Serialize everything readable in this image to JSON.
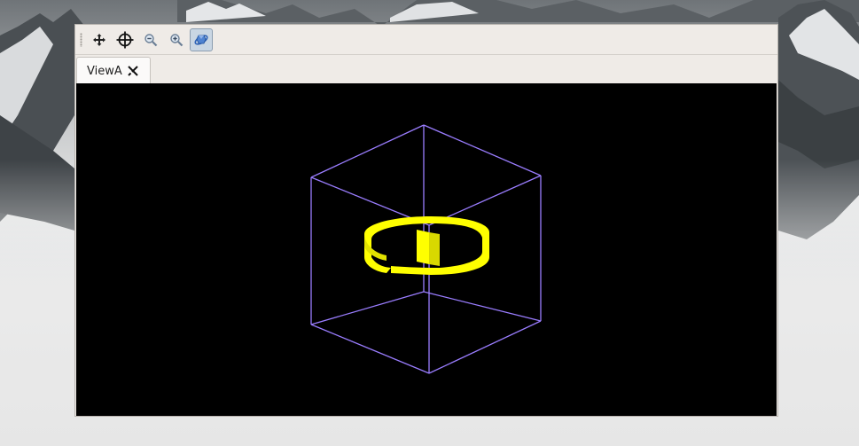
{
  "toolbar": {
    "buttons": [
      {
        "icon": "move-icon",
        "active": false
      },
      {
        "icon": "crosshair-icon",
        "active": false
      },
      {
        "icon": "zoom-out-icon",
        "active": false
      },
      {
        "icon": "zoom-in-icon",
        "active": false
      },
      {
        "icon": "rotate-view-icon",
        "active": true
      }
    ]
  },
  "tabs": [
    {
      "label": "ViewA",
      "close_icon": "close-tab-icon"
    }
  ],
  "viewport": {
    "background": "#000000",
    "bounding_box_color": "#9a7dff",
    "object_color": "#ffff00"
  }
}
